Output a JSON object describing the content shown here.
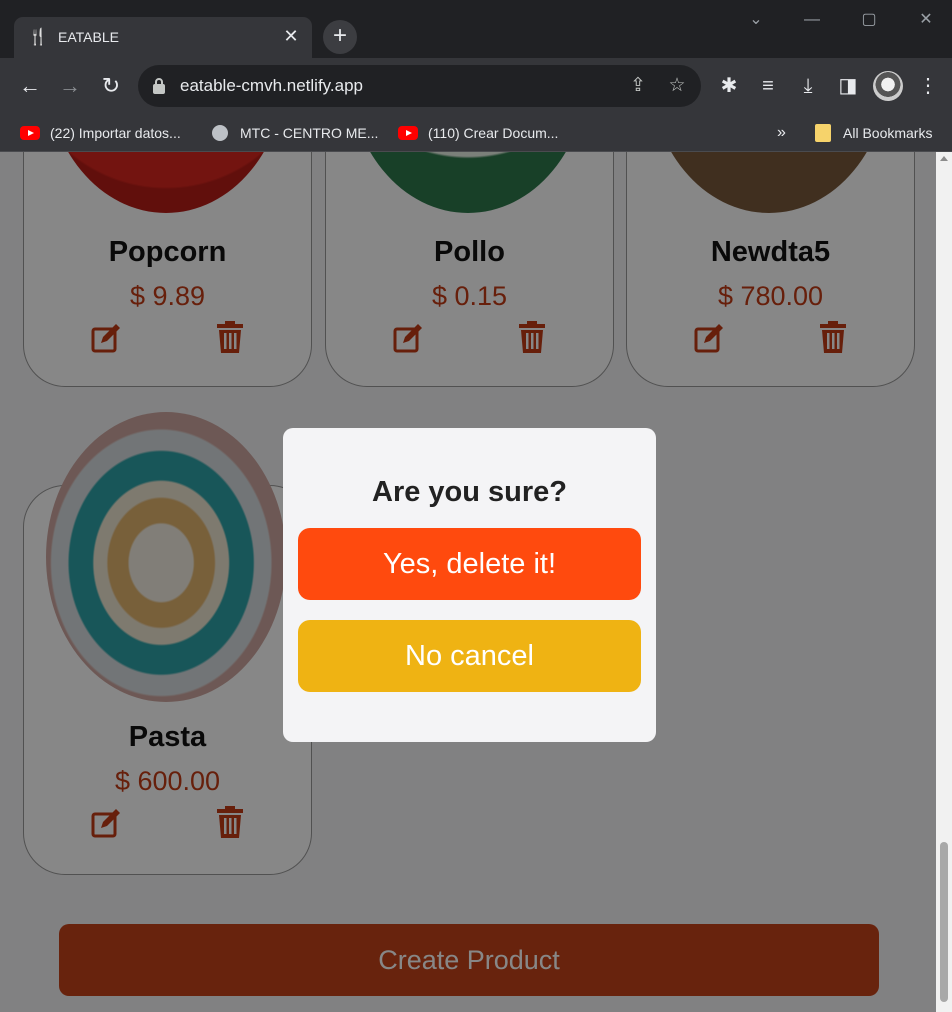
{
  "browser": {
    "tab_title": "EATABLE",
    "url": "eatable-cmvh.netlify.app",
    "bookmarks": [
      {
        "label": "(22) Importar datos..."
      },
      {
        "label": "MTC - CENTRO ME..."
      },
      {
        "label": "(110) Crear Docum..."
      }
    ],
    "bookmarks_overflow": "»",
    "all_bookmarks": "All Bookmarks"
  },
  "products": [
    {
      "name": "Popcorn",
      "price": "$ 9.89"
    },
    {
      "name": "Pollo",
      "price": "$ 0.15"
    },
    {
      "name": "Newdta5",
      "price": "$ 780.00"
    },
    {
      "name": "Pasta",
      "price": "$ 600.00"
    }
  ],
  "create_button": "Create Product",
  "modal": {
    "title": "Are you sure?",
    "confirm_label": "Yes, delete it!",
    "cancel_label": "No cancel"
  },
  "colors": {
    "confirm": "#ff4a0e",
    "cancel": "#efb313",
    "price": "#c23c16",
    "create": "#c5421a"
  },
  "icons": {
    "edit": "edit-icon",
    "delete": "trash-icon"
  }
}
